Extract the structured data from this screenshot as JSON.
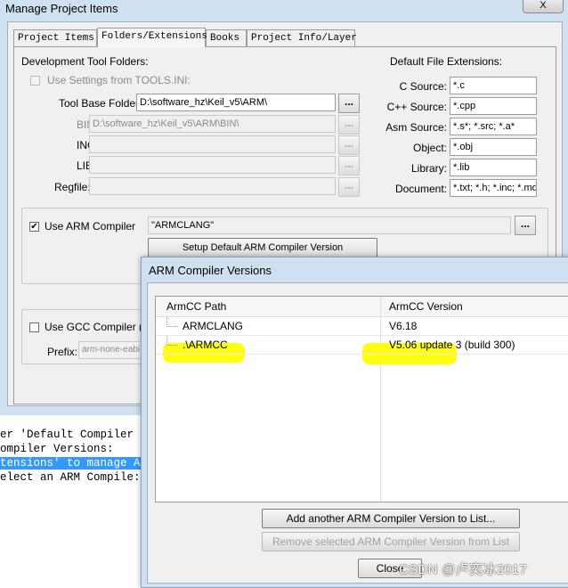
{
  "main_dialog": {
    "title": "Manage Project Items",
    "close_label": "X",
    "tabs": [
      "Project Items",
      "Folders/Extensions",
      "Books",
      "Project Info/Layer"
    ],
    "active_tab": "Folders/Extensions",
    "dev_tool_folders": {
      "heading": "Development Tool Folders:",
      "use_settings_label": "Use Settings from TOOLS.INI:",
      "tool_base_label": "Tool Base Folder:",
      "tool_base_value": "D:\\software_hz\\Keil_v5\\ARM\\",
      "bin_label": "BIN:",
      "bin_value": "D:\\software_hz\\Keil_v5\\ARM\\BIN\\",
      "inc_label": "INC:",
      "lib_label": "LIB:",
      "regfile_label": "Regfile:",
      "browse_label": "..."
    },
    "default_extensions": {
      "heading": "Default File Extensions:",
      "items": [
        {
          "label": "C Source:",
          "value": "*.c"
        },
        {
          "label": "C++ Source:",
          "value": "*.cpp"
        },
        {
          "label": "Asm Source:",
          "value": "*.s*; *.src; *.a*"
        },
        {
          "label": "Object:",
          "value": "*.obj"
        },
        {
          "label": "Library:",
          "value": "*.lib"
        },
        {
          "label": "Document:",
          "value": "*.txt; *.h; *.inc; *.md"
        }
      ]
    },
    "arm_compiler": {
      "checkbox_label": "Use ARM Compiler",
      "checked_mark": "✔",
      "value": "\"ARMCLANG\"",
      "browse_label": "...",
      "setup_button": "Setup Default ARM Compiler Version"
    },
    "gcc_compiler": {
      "checkbox_label": "Use GCC Compiler (GN",
      "prefix_label": "Prefix:",
      "prefix_value": "arm-none-eabi"
    }
  },
  "console": {
    "lines": [
      {
        "text": "er 'Default Compiler",
        "selected": false
      },
      {
        "text": "ompiler Versions:",
        "selected": false
      },
      {
        "text": "tensions' to manage A",
        "selected": true
      },
      {
        "text": "elect an ARM Compile:",
        "selected": false
      }
    ]
  },
  "arm_dialog": {
    "title": "ARM Compiler Versions",
    "columns": [
      "ArmCC Path",
      "ArmCC Version"
    ],
    "rows": [
      {
        "path": "ARMCLANG",
        "version": "V6.18"
      },
      {
        "path": ".\\ARMCC",
        "version": "V5.06 update 3 (build 300)"
      }
    ],
    "add_button": "Add another ARM Compiler Version to List...",
    "remove_button": "Remove selected ARM Compiler Version from List",
    "close_button": "Close"
  },
  "watermark": "CSDN @卢奕冰2017",
  "colors": {
    "highlight": "#ffff00",
    "selection": "#3399ff",
    "title_bar": "#cfe0f0"
  }
}
